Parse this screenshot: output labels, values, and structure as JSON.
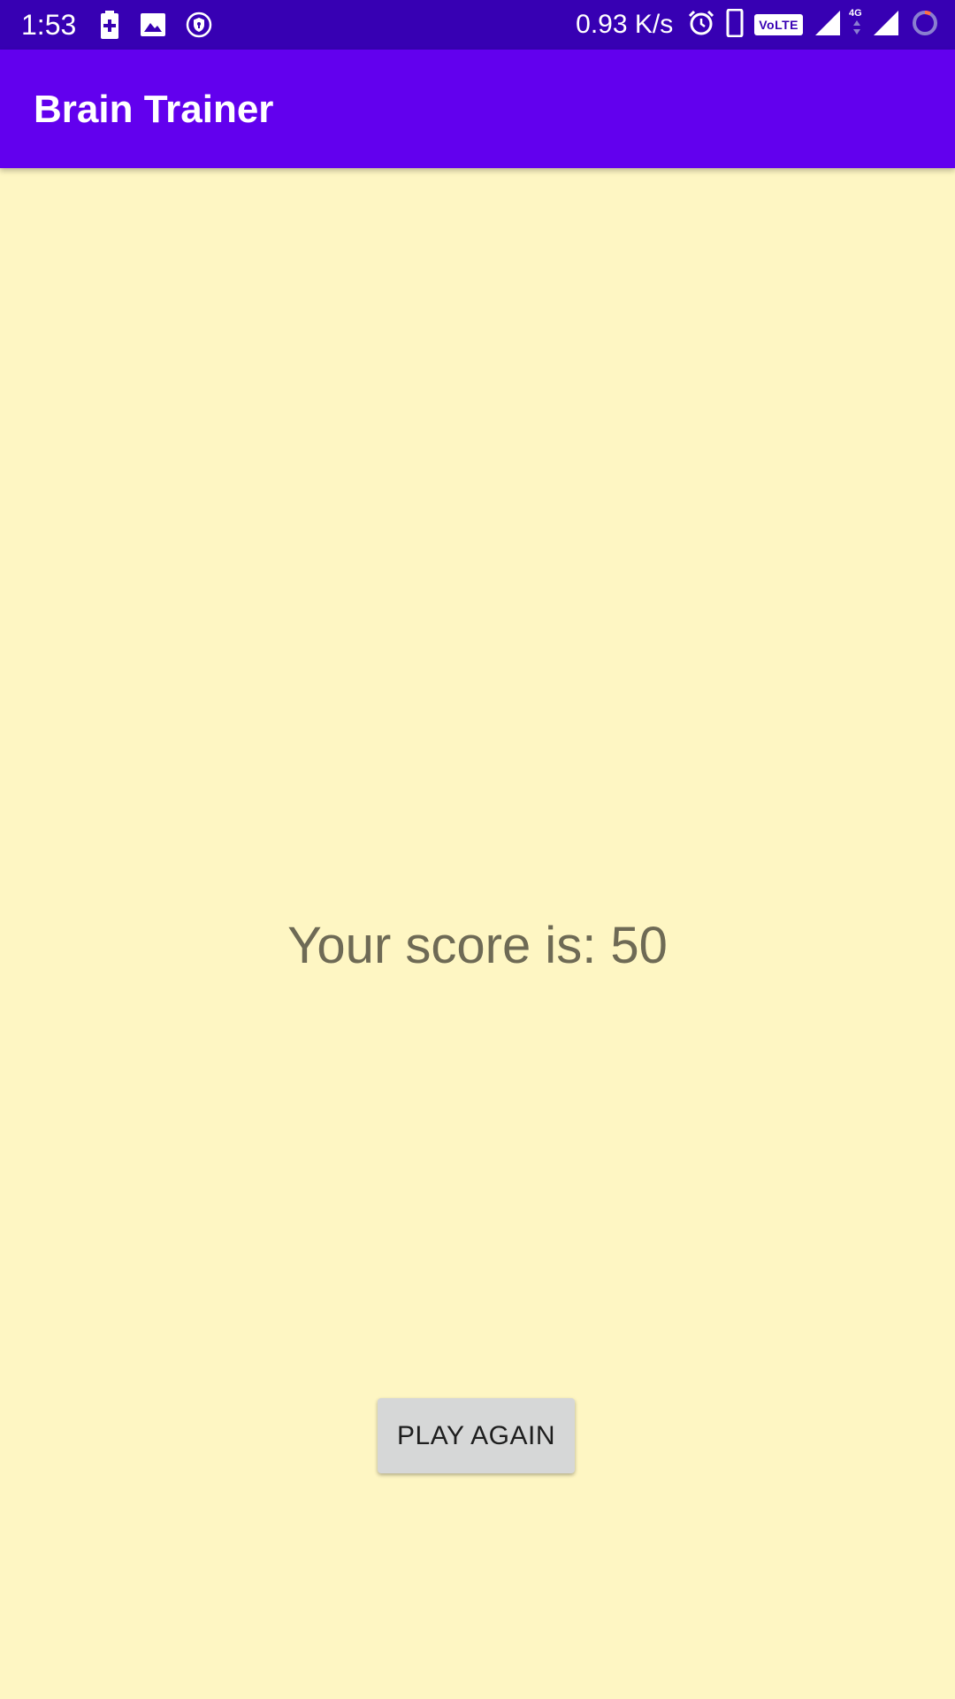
{
  "status_bar": {
    "time": "1:53",
    "net_speed": "0.93 K/s",
    "volte_label": "VoLTE",
    "network_type": "4G",
    "icons": [
      "battery-saver-icon",
      "image-icon",
      "shield-icon",
      "alarm-icon",
      "phone-icon",
      "volte-icon",
      "signal-icon",
      "signal-icon",
      "loading-icon"
    ],
    "background_color": "#3700B3"
  },
  "app_bar": {
    "title": "Brain Trainer",
    "background_color": "#6200EE"
  },
  "main": {
    "score_text": "Your score is: 50",
    "play_again_label": "PLAY AGAIN",
    "background_color": "#FEF6C3"
  }
}
